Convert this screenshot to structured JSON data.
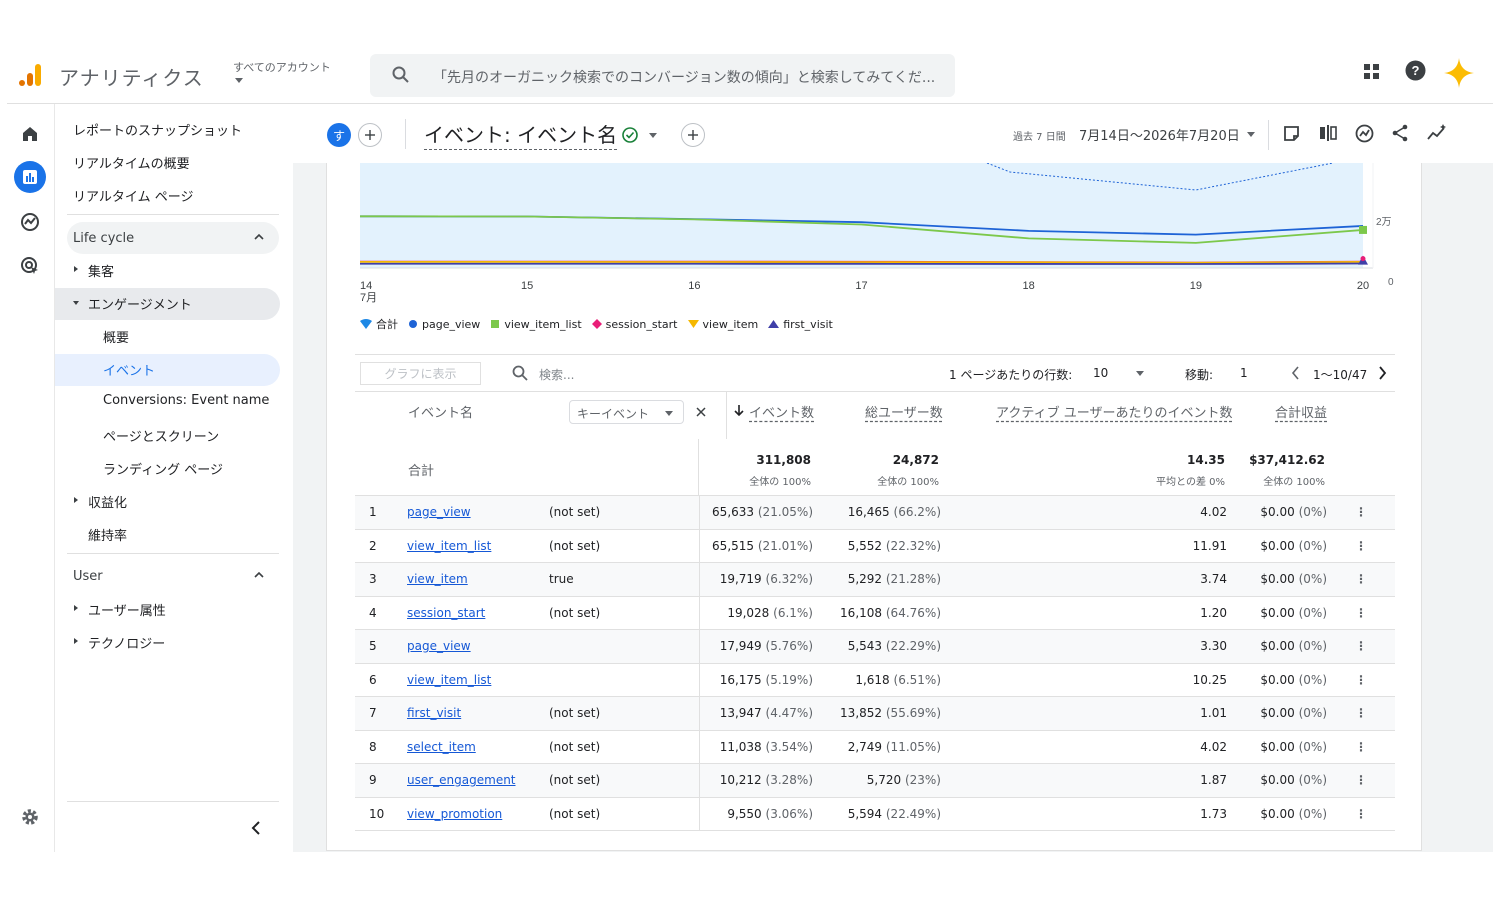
{
  "header": {
    "app_name": "アナリティクス",
    "account_label": "すべてのアカウント",
    "search_placeholder": "「先月のオーガニック検索でのコンバージョン数の傾向」と検索してみてくだ..."
  },
  "rail": {
    "icons": [
      "home-icon",
      "reports-icon",
      "explore-icon",
      "advertising-icon",
      "settings-icon"
    ]
  },
  "nav": {
    "top_items": [
      "レポートのスナップショット",
      "リアルタイムの概要",
      "リアルタイム ページ"
    ],
    "lifecycle_label": "Life cycle",
    "acquisition": "集客",
    "engagement": "エンゲージメント",
    "engagement_children": [
      "概要",
      "イベント",
      "Conversions: Event name",
      "ページとスクリーン",
      "ランディング ページ"
    ],
    "monetization": "収益化",
    "retention": "維持率",
    "user_label": "User",
    "user_attributes": "ユーザー属性",
    "technology": "テクノロジー"
  },
  "toolbar": {
    "avatar_letter": "す",
    "report_title": "イベント: イベント名",
    "date_prefix": "過去 7 日間",
    "date_range": "7月14日～2026年7月20日"
  },
  "chart_data": {
    "type": "line",
    "x": [
      "14",
      "15",
      "16",
      "17",
      "18",
      "19",
      "20"
    ],
    "x_month_label": "7月",
    "y_ticks": [
      "0",
      "2万"
    ],
    "series": [
      {
        "name": "合計",
        "values": [
          null,
          null,
          null,
          null,
          null,
          null,
          null
        ]
      },
      {
        "name": "page_view",
        "values": [
          22000,
          21900,
          20800,
          19500,
          15800,
          14200,
          17900
        ]
      },
      {
        "name": "view_item_list",
        "values": [
          22000,
          21900,
          20700,
          18500,
          12600,
          10700,
          16200
        ]
      },
      {
        "name": "session_start",
        "values": [
          2700,
          2700,
          2700,
          2650,
          2500,
          2300,
          2700
        ]
      },
      {
        "name": "view_item",
        "values": [
          2600,
          2600,
          2550,
          2500,
          2450,
          2200,
          2600
        ]
      },
      {
        "name": "first_visit",
        "values": [
          1800,
          1800,
          1800,
          1780,
          1720,
          1700,
          1900
        ]
      }
    ],
    "colors": {
      "合計": "#1e88e5",
      "page_view": "#1e63d6",
      "view_item_list": "#7cc84b",
      "session_start": "#e91e78",
      "view_item": "#f5b800",
      "first_visit": "#3f3fa8"
    }
  },
  "table_controls": {
    "graph_button": "グラフに表示",
    "search_placeholder": "検索...",
    "rows_label": "1 ページあたりの行数:",
    "rows_value": "10",
    "goto_label": "移動:",
    "goto_value": "1",
    "range": "1〜10/47"
  },
  "table": {
    "headers": {
      "event_name": "イベント名",
      "key_event": "キーイベント",
      "events": "イベント数",
      "users": "総ユーザー数",
      "per_user": "アクティブ ユーザーあたりのイベント数",
      "revenue": "合計収益"
    },
    "totals": {
      "label": "合計",
      "events": "311,808",
      "events_sub": "全体の 100%",
      "users": "24,872",
      "users_sub": "全体の 100%",
      "per_user": "14.35",
      "per_user_sub": "平均との差 0%",
      "revenue": "$37,412.62",
      "revenue_sub": "全体の 100%"
    },
    "rows": [
      {
        "idx": "1",
        "name": "page_view",
        "key": "(not set)",
        "events": "65,633",
        "events_pct": "(21.05%)",
        "users": "16,465",
        "users_pct": "(66.2%)",
        "per_user": "4.02",
        "revenue": "$0.00",
        "revenue_pct": "(0%)"
      },
      {
        "idx": "2",
        "name": "view_item_list",
        "key": "(not set)",
        "events": "65,515",
        "events_pct": "(21.01%)",
        "users": "5,552",
        "users_pct": "(22.32%)",
        "per_user": "11.91",
        "revenue": "$0.00",
        "revenue_pct": "(0%)"
      },
      {
        "idx": "3",
        "name": "view_item",
        "key": "true",
        "events": "19,719",
        "events_pct": "(6.32%)",
        "users": "5,292",
        "users_pct": "(21.28%)",
        "per_user": "3.74",
        "revenue": "$0.00",
        "revenue_pct": "(0%)"
      },
      {
        "idx": "4",
        "name": "session_start",
        "key": "(not set)",
        "events": "19,028",
        "events_pct": "(6.1%)",
        "users": "16,108",
        "users_pct": "(64.76%)",
        "per_user": "1.20",
        "revenue": "$0.00",
        "revenue_pct": "(0%)"
      },
      {
        "idx": "5",
        "name": "page_view",
        "key": "",
        "events": "17,949",
        "events_pct": "(5.76%)",
        "users": "5,543",
        "users_pct": "(22.29%)",
        "per_user": "3.30",
        "revenue": "$0.00",
        "revenue_pct": "(0%)"
      },
      {
        "idx": "6",
        "name": "view_item_list",
        "key": "",
        "events": "16,175",
        "events_pct": "(5.19%)",
        "users": "1,618",
        "users_pct": "(6.51%)",
        "per_user": "10.25",
        "revenue": "$0.00",
        "revenue_pct": "(0%)"
      },
      {
        "idx": "7",
        "name": "first_visit",
        "key": "(not set)",
        "events": "13,947",
        "events_pct": "(4.47%)",
        "users": "13,852",
        "users_pct": "(55.69%)",
        "per_user": "1.01",
        "revenue": "$0.00",
        "revenue_pct": "(0%)"
      },
      {
        "idx": "8",
        "name": "select_item",
        "key": "(not set)",
        "events": "11,038",
        "events_pct": "(3.54%)",
        "users": "2,749",
        "users_pct": "(11.05%)",
        "per_user": "4.02",
        "revenue": "$0.00",
        "revenue_pct": "(0%)"
      },
      {
        "idx": "9",
        "name": "user_engagement",
        "key": "(not set)",
        "events": "10,212",
        "events_pct": "(3.28%)",
        "users": "5,720",
        "users_pct": "(23%)",
        "per_user": "1.87",
        "revenue": "$0.00",
        "revenue_pct": "(0%)"
      },
      {
        "idx": "10",
        "name": "view_promotion",
        "key": "(not set)",
        "events": "9,550",
        "events_pct": "(3.06%)",
        "users": "5,594",
        "users_pct": "(22.49%)",
        "per_user": "1.73",
        "revenue": "$0.00",
        "revenue_pct": "(0%)"
      }
    ]
  }
}
